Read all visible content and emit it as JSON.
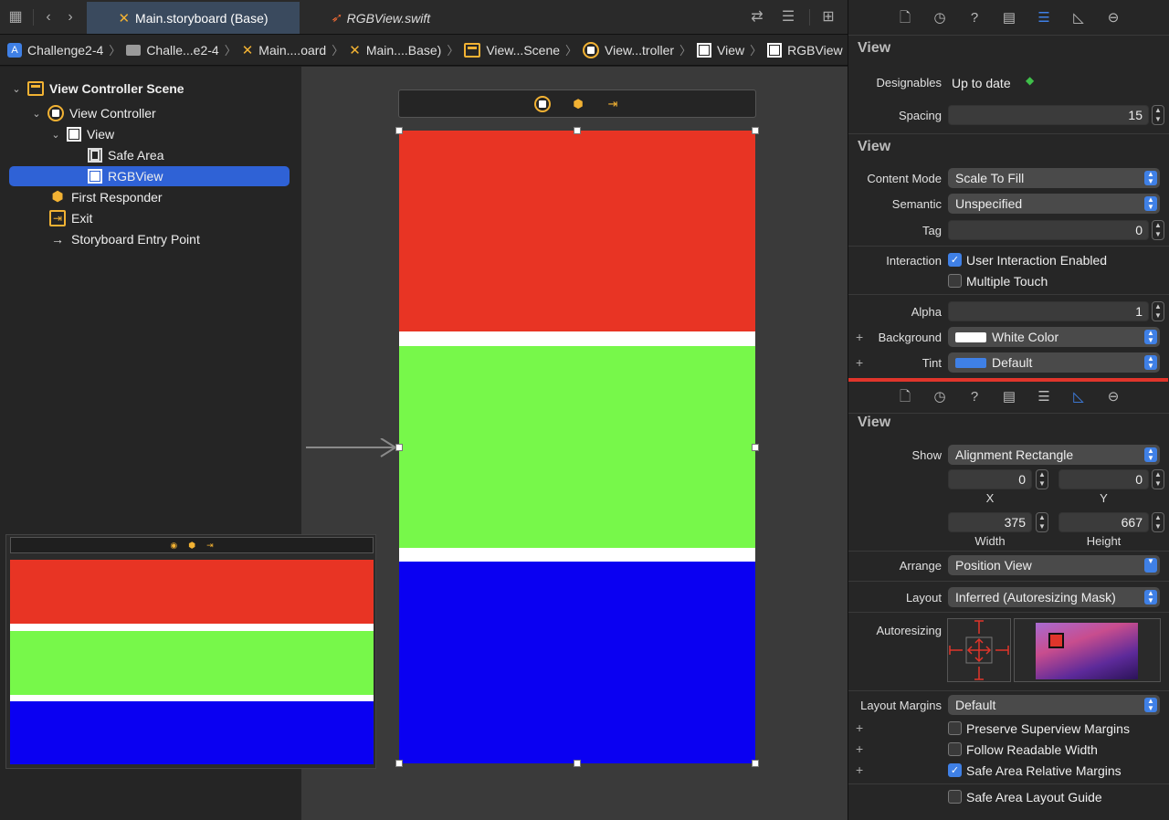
{
  "tabs": {
    "main_label": "Main.storyboard (Base)",
    "swift_label": "RGBView.swift"
  },
  "breadcrumb": {
    "items": [
      "Challenge2-4",
      "Challe...e2-4",
      "Main....oard",
      "Main....Base)",
      "View...Scene",
      "View...troller",
      "View",
      "RGBView"
    ]
  },
  "outline": {
    "scene": "View Controller Scene",
    "view_controller": "View Controller",
    "view": "View",
    "safe_area": "Safe Area",
    "rgb_view": "RGBView",
    "first_responder": "First Responder",
    "exit": "Exit",
    "entry_point": "Storyboard Entry Point"
  },
  "canvas": {
    "colors": {
      "red": "#e83424",
      "green": "#77f84a",
      "blue": "#0a00f2"
    }
  },
  "attributes": {
    "section_title": "View",
    "designables_label": "Designables",
    "designables_value": "Up to date",
    "spacing_label": "Spacing",
    "spacing_value": "15",
    "view_section_title": "View",
    "content_mode_label": "Content Mode",
    "content_mode_value": "Scale To Fill",
    "semantic_label": "Semantic",
    "semantic_value": "Unspecified",
    "tag_label": "Tag",
    "tag_value": "0",
    "interaction_label": "Interaction",
    "user_interaction_label": "User Interaction Enabled",
    "multiple_touch_label": "Multiple Touch",
    "alpha_label": "Alpha",
    "alpha_value": "1",
    "background_label": "Background",
    "background_value": "White Color",
    "tint_label": "Tint",
    "tint_value": "Default"
  },
  "size": {
    "section_title": "View",
    "show_label": "Show",
    "show_value": "Alignment Rectangle",
    "x_value": "0",
    "y_value": "0",
    "x_label": "X",
    "y_label": "Y",
    "width_value": "375",
    "height_value": "667",
    "width_label": "Width",
    "height_label": "Height",
    "arrange_label": "Arrange",
    "arrange_value": "Position View",
    "layout_label": "Layout",
    "layout_value": "Inferred (Autoresizing Mask)",
    "autoresizing_label": "Autoresizing",
    "layout_margins_label": "Layout Margins",
    "layout_margins_value": "Default",
    "preserve_label": "Preserve Superview Margins",
    "readable_label": "Follow Readable Width",
    "safe_margins_label": "Safe Area Relative Margins",
    "safe_guide_label": "Safe Area Layout Guide"
  }
}
